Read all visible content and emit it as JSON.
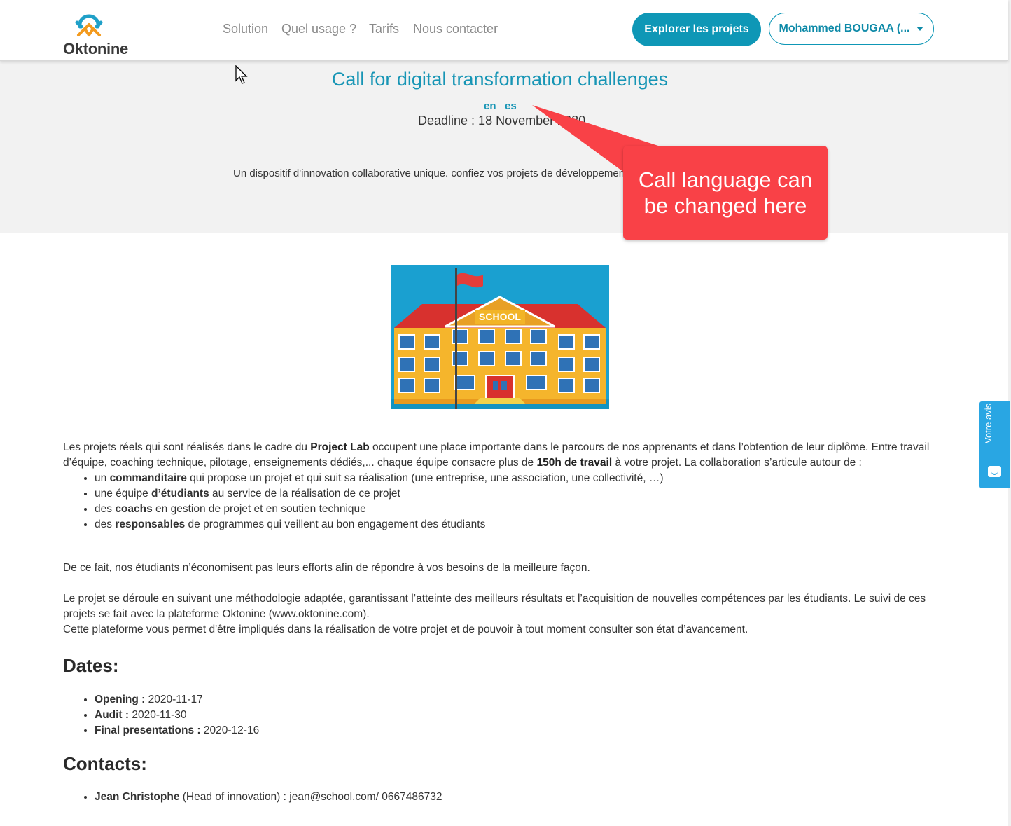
{
  "header": {
    "logo_text": "Oktonine",
    "nav": [
      "Solution",
      "Quel usage ?",
      "Tarifs",
      "Nous contacter"
    ],
    "explore_button": "Explorer les projets",
    "user_button": "Mohammed BOUGAA (..."
  },
  "hero": {
    "title": "Call for digital transformation challenges",
    "languages": [
      "en",
      "es"
    ],
    "deadline": "Deadline : 18 November 2020",
    "intro": "Un dispositif d'innovation collaborative unique.  confiez vos projets de développement"
  },
  "callout": {
    "line1": "Call language can",
    "line2": "be changed here"
  },
  "image": {
    "sign": "SCHOOL"
  },
  "content": {
    "p1_a": "Les projets réels qui sont réalisés dans le cadre du ",
    "p1_b": "Project Lab",
    "p1_c": " occupent une place importante dans le parcours de nos apprenants et dans l’obtention de leur diplôme. Entre travail d’équipe, coaching technique, pilotage, enseignements dédiés,... chaque équipe consacre plus de ",
    "p1_d": "150h de travail",
    "p1_e": " à votre projet. La collaboration s’articule autour de :",
    "roles": [
      {
        "pre": "un ",
        "bold": "commanditaire",
        "post": " qui propose un projet et qui suit sa réalisation (une entreprise, une association, une collectivité, …)"
      },
      {
        "pre": "une équipe ",
        "bold": "d’étudiants",
        "post": " au service de la réalisation de ce projet"
      },
      {
        "pre": "des ",
        "bold": "coachs",
        "post": " en gestion de projet et en soutien technique"
      },
      {
        "pre": "des ",
        "bold": "responsables",
        "post": " de programmes qui veillent au bon engagement des étudiants"
      }
    ],
    "p2": "De ce fait, nos étudiants n’économisent pas leurs efforts afin de répondre à vos besoins de la meilleure façon.",
    "p3a": "Le projet se déroule en suivant une méthodologie adaptée, garantissant l’atteinte des meilleurs résultats et l’acquisition de nouvelles compétences par les étudiants. Le suivi de ces projets se fait avec la plateforme Oktonine (www.oktonine.com).",
    "p3b": "Cette plateforme vous permet d'être impliqués dans la réalisation de votre projet et de pouvoir à tout moment consulter son état d’avancement.",
    "dates_heading": "Dates:",
    "dates": [
      {
        "label": "Opening :",
        "value": " 2020-11-17"
      },
      {
        "label": "Audit :",
        "value": " 2020-11-30"
      },
      {
        "label": "Final presentations :",
        "value": " 2020-12-16"
      }
    ],
    "contacts_heading": "Contacts:",
    "contacts": [
      {
        "name": "Jean Christophe",
        "detail": " (Head of innovation) : jean@school.com/ 0667486732"
      }
    ]
  },
  "feedback": {
    "label": "Votre avis"
  }
}
